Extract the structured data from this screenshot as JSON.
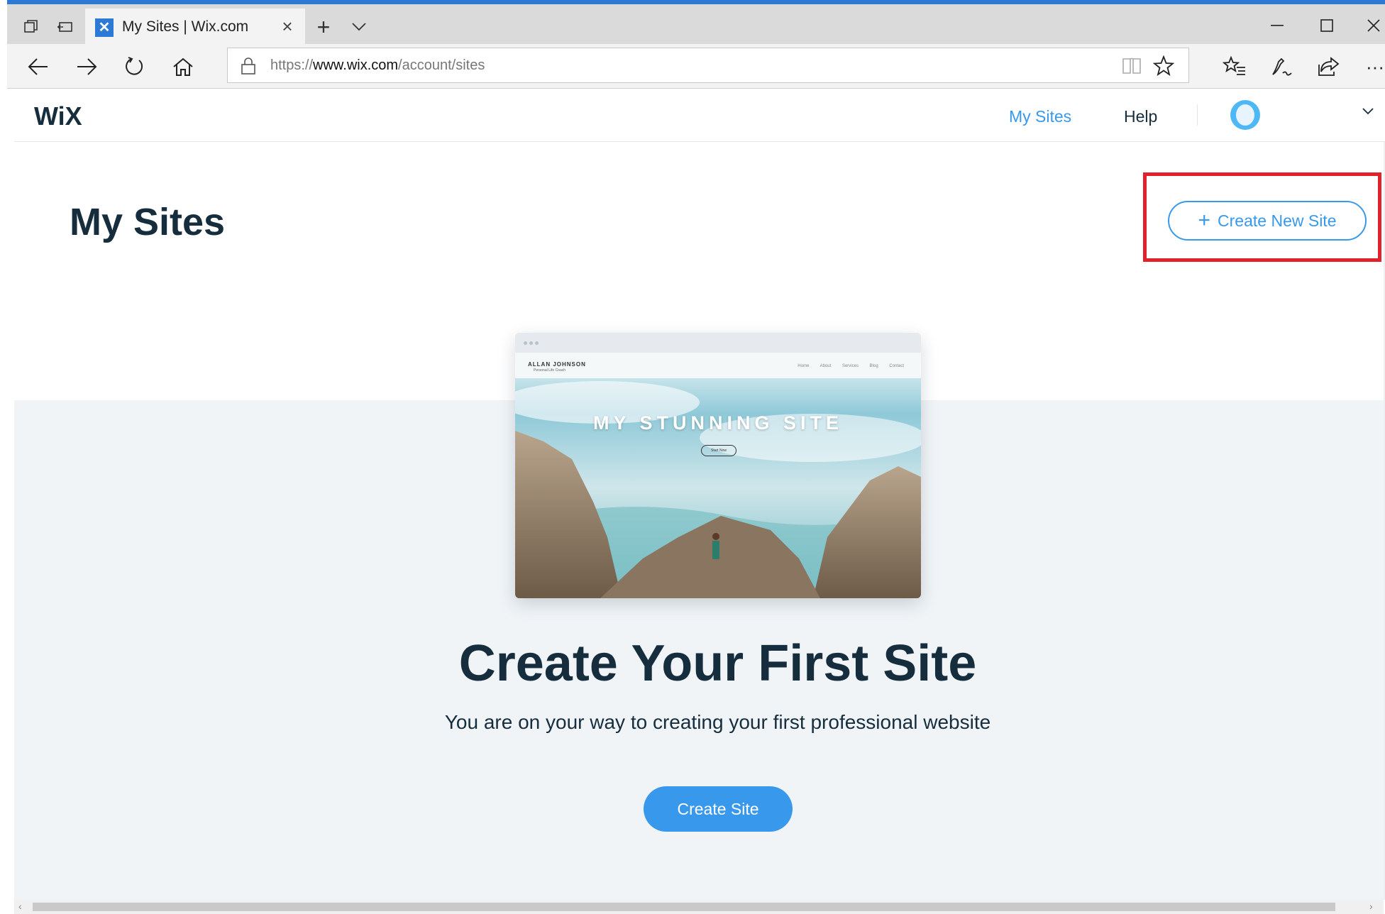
{
  "browser": {
    "tab": {
      "title": "My Sites | Wix.com",
      "favicon_icon": "wix-favicon-icon"
    },
    "new_tab_label": "+",
    "address": {
      "prefix": "https://",
      "domain": "www.wix.com",
      "path": "/account/sites"
    },
    "accent_color": "#2b79d0"
  },
  "wix_header": {
    "logo": "WiX",
    "nav": [
      {
        "label": "My Sites",
        "active": true
      },
      {
        "label": "Help",
        "active": false
      }
    ]
  },
  "page": {
    "title": "My Sites",
    "create_new_site_label": "Create New Site",
    "preview": {
      "site_name": "ALLAN JOHNSON",
      "site_subtitle": "Personal Life Coach",
      "menu": "Home About Services Blog Contact",
      "headline": "MY STUNNING SITE",
      "cta": "Start Now"
    },
    "headline": "Create Your First Site",
    "subline": "You are on your way to creating your first professional website",
    "create_site_label": "Create Site"
  },
  "colors": {
    "wix_blue": "#3899ec",
    "highlight_red": "#e0202a",
    "text_dark": "#162d3d",
    "bg_light": "#f0f4f7"
  }
}
